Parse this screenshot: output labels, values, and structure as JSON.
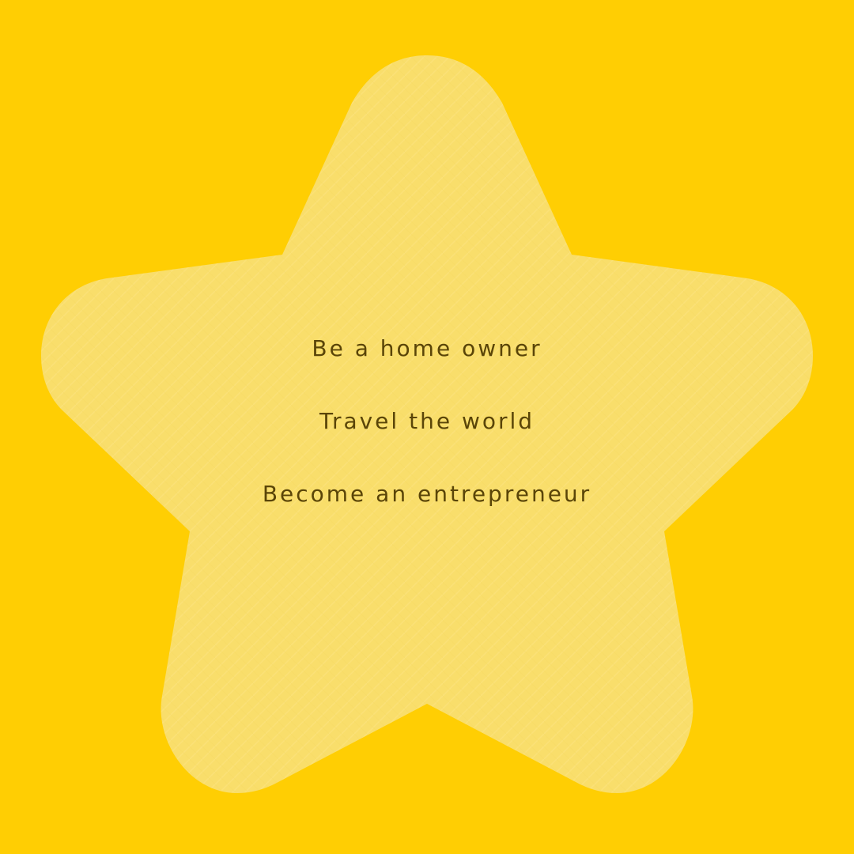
{
  "colors": {
    "background": "#FFCE03",
    "star_fill": "#F9DE6B",
    "text": "#5A4508"
  },
  "goals": [
    "Be a home owner",
    "Travel the world",
    "Become an entrepreneur"
  ]
}
